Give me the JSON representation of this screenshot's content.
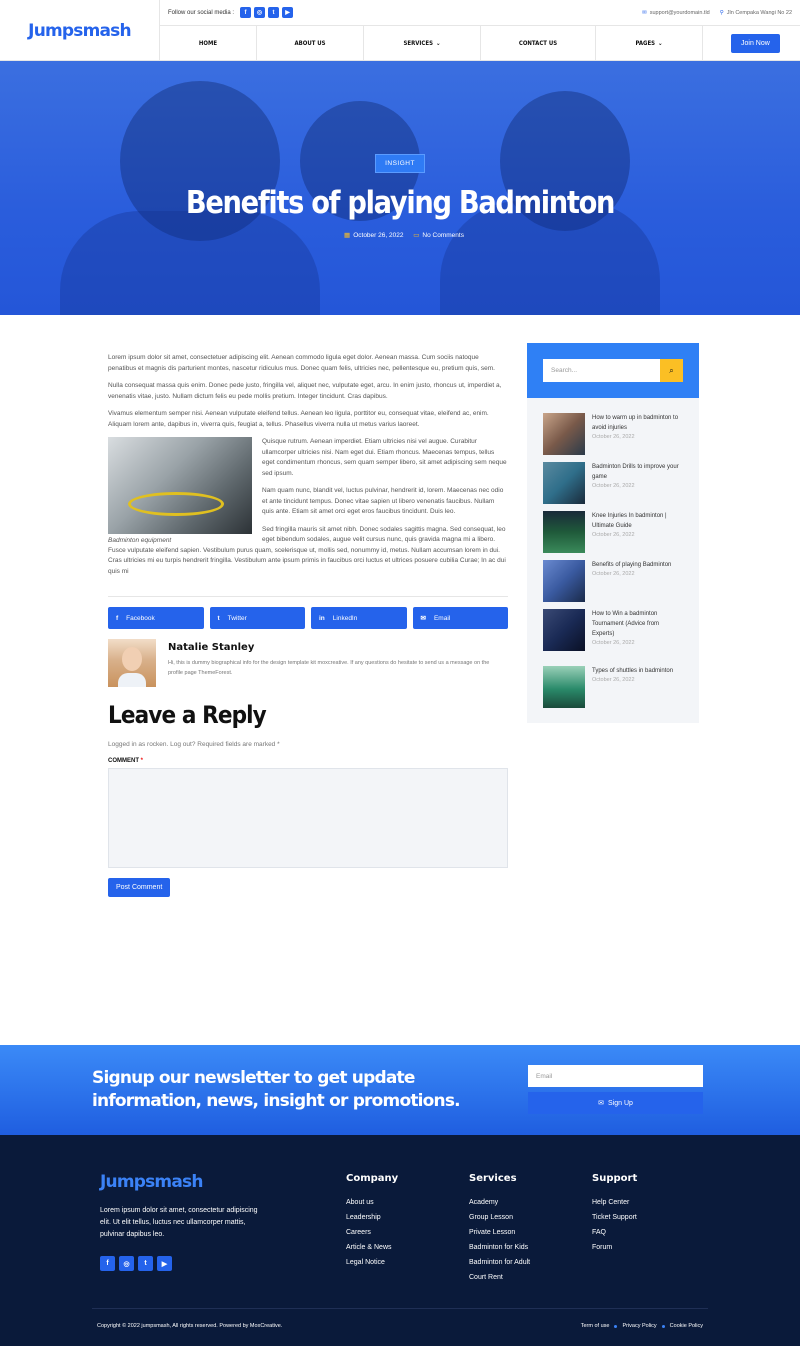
{
  "header": {
    "logo": "Jumpsmash",
    "follow_label": "Follow our social media :",
    "social": [
      "f",
      "◎",
      "t",
      "▶"
    ],
    "email": "support@yourdomain.tld",
    "address": "Jln Cempaka Wangi No 22",
    "nav": [
      {
        "label": "HOME",
        "dropdown": false
      },
      {
        "label": "ABOUT US",
        "dropdown": false
      },
      {
        "label": "SERVICES",
        "dropdown": true
      },
      {
        "label": "CONTACT US",
        "dropdown": false
      },
      {
        "label": "PAGES",
        "dropdown": true
      }
    ],
    "join_label": "Join Now"
  },
  "hero": {
    "tag": "INSIGHT",
    "title": "Benefits of playing Badminton",
    "date": "October 26, 2022",
    "comments": "No Comments"
  },
  "article": {
    "p1": "Lorem ipsum dolor sit amet, consectetuer adipiscing elit. Aenean commodo ligula eget dolor. Aenean massa. Cum sociis natoque penatibus et magnis dis parturient montes, nascetur ridiculus mus. Donec quam felis, ultricies nec, pellentesque eu, pretium quis, sem.",
    "p2": "Nulla consequat massa quis enim. Donec pede justo, fringilla vel, aliquet nec, vulputate eget, arcu. In enim justo, rhoncus ut, imperdiet a, venenatis vitae, justo. Nullam dictum felis eu pede mollis pretium. Integer tincidunt. Cras dapibus.",
    "p3": "Vivamus elementum semper nisi. Aenean vulputate eleifend tellus. Aenean leo ligula, porttitor eu, consequat vitae, eleifend ac, enim. Aliquam lorem ante, dapibus in, viverra quis, feugiat a, tellus. Phasellus viverra nulla ut metus varius laoreet.",
    "p4": "Quisque rutrum. Aenean imperdiet. Etiam ultricies nisi vel augue. Curabitur ullamcorper ultricies nisi. Nam eget dui. Etiam rhoncus. Maecenas tempus, tellus eget condimentum rhoncus, sem quam semper libero, sit amet adipiscing sem neque sed ipsum.",
    "p5": "Nam quam nunc, blandit vel, luctus pulvinar, hendrerit id, lorem. Maecenas nec odio et ante tincidunt tempus. Donec vitae sapien ut libero venenatis faucibus. Nullam quis ante. Etiam sit amet orci eget eros faucibus tincidunt. Duis leo.",
    "p6": "Sed fringilla mauris sit amet nibh. Donec sodales sagittis magna. Sed consequat, leo eget bibendum sodales, augue velit cursus nunc, quis gravida magna mi a libero. Fusce vulputate eleifend sapien. Vestibulum purus quam, scelerisque ut, mollis sed, nonummy id, metus. Nullam accumsan lorem in dui. Cras ultricies mi eu turpis hendrerit fringilla. Vestibulum ante ipsum primis in faucibus orci luctus et ultrices posuere cubilia Curae; In ac dui quis mi",
    "caption": "Badminton equipment"
  },
  "share": [
    {
      "label": "Facebook",
      "icon": "f"
    },
    {
      "label": "Twitter",
      "icon": "t"
    },
    {
      "label": "LinkedIn",
      "icon": "in"
    },
    {
      "label": "Email",
      "icon": "✉"
    }
  ],
  "author": {
    "name": "Natalie Stanley",
    "bio": "Hi, this is dummy biographical info for the design template kit moxcreative. If any questions do hesitate to send us a message on the profile page ThemeForest."
  },
  "reply": {
    "title": "Leave a Reply",
    "logged": "Logged in as rocken. Log out? Required fields are marked *",
    "comment_label": "COMMENT",
    "required_mark": "*",
    "post_label": "Post Comment"
  },
  "sidebar": {
    "search_placeholder": "Search...",
    "posts": [
      {
        "title": "How to warm up in badminton to avoid injuries",
        "date": "October 26, 2022",
        "color": "#7a5a4a"
      },
      {
        "title": "Badminton Drills to improve your game",
        "date": "October 26, 2022",
        "color": "#2f6e8a"
      },
      {
        "title": "Knee Injuries In badminton | Ultimate Guide",
        "date": "October 26, 2022",
        "color": "#1f5a3a"
      },
      {
        "title": "Benefits of playing Badminton",
        "date": "October 26, 2022",
        "color": "#3a5aa0"
      },
      {
        "title": "How to Win a badminton Tournament (Advice from Experts)",
        "date": "October 26, 2022",
        "color": "#1a2a55"
      },
      {
        "title": "Types of shuttles in badminton",
        "date": "October 26, 2022",
        "color": "#2a8a6a"
      }
    ]
  },
  "newsletter": {
    "text": "Signup our newsletter to get update information, news, insight or promotions.",
    "email_placeholder": "Email",
    "button": "Sign Up"
  },
  "footer": {
    "logo": "Jumpsmash",
    "desc": "Lorem ipsum dolor sit amet, consectetur adipiscing elit. Ut elit tellus, luctus nec ullamcorper mattis, pulvinar dapibus leo.",
    "company": {
      "title": "Company",
      "links": [
        "About us",
        "Leadership",
        "Careers",
        "Article & News",
        "Legal Notice"
      ]
    },
    "services": {
      "title": "Services",
      "links": [
        "Academy",
        "Group Lesson",
        "Private Lesson",
        "Badminton for Kids",
        "Badminton for Adult",
        "Court Rent"
      ]
    },
    "support": {
      "title": "Support",
      "links": [
        "Help Center",
        "Ticket Support",
        "FAQ",
        "Forum"
      ]
    },
    "copyright": "Copyright © 2022 jumpsmash, All rights reserved. Powered by MoxCreative.",
    "bottom_links": [
      "Term of use",
      "Privacy Policy",
      "Cookie Policy"
    ]
  }
}
